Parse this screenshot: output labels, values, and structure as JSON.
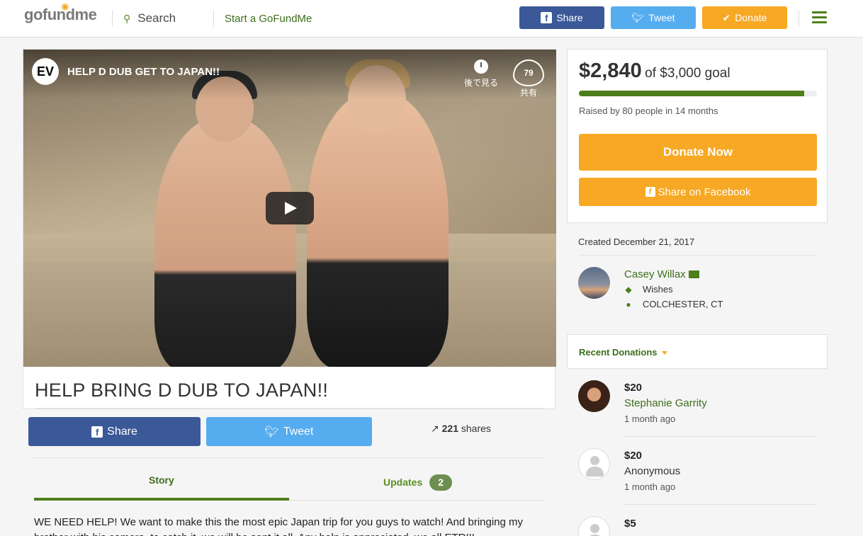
{
  "header": {
    "logo": "gofundme",
    "search_label": "Search",
    "start_label": "Start a GoFundMe",
    "share_label": "Share",
    "tweet_label": "Tweet",
    "donate_label": "Donate",
    "colors": {
      "facebook": "#3b5998",
      "twitter": "#55acee",
      "donate": "#f7a824",
      "brand_green": "#4e7f1b"
    }
  },
  "video": {
    "channel_logo": "EV",
    "title": "HELP D DUB GET TO JAPAN!!",
    "watch_later": "後で見る",
    "like_count": "79",
    "share_label": "共有"
  },
  "campaign": {
    "title": "HELP BRING D DUB TO JAPAN!!",
    "share_button": "Share",
    "tweet_button": "Tweet",
    "share_count": "221",
    "share_count_label": "shares",
    "tabs": {
      "story": "Story",
      "updates": "Updates",
      "updates_count": "2"
    },
    "story_text": "WE NEED HELP! We want to make this the most epic Japan trip for you guys to watch! And bringing my brother with his camera, to catch it, we will be sent it all. Any help is appreciated, we all ETR!!!"
  },
  "funding": {
    "raised": "$2,840",
    "goal_text": "of $3,000 goal",
    "progress_fraction": 0.947,
    "raised_by": "Raised by 80 people in 14 months",
    "donate_now": "Donate Now",
    "share_facebook": "Share on Facebook"
  },
  "organizer": {
    "created": "Created December 21, 2017",
    "name": "Casey Willax",
    "category": "Wishes",
    "location": "COLCHESTER, CT"
  },
  "donations": {
    "header": "Recent Donations",
    "items": [
      {
        "amount": "$20",
        "name": "Stephanie Garrity",
        "time": "1 month ago"
      },
      {
        "amount": "$20",
        "name": "Anonymous",
        "time": "1 month ago"
      },
      {
        "amount": "$5"
      }
    ]
  }
}
